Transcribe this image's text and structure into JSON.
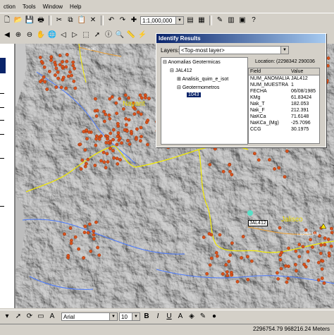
{
  "menu": [
    "ction",
    "Tools",
    "Window",
    "Help"
  ],
  "toolbar1": {
    "scale": "1:1,000,000"
  },
  "map": {
    "labels": {
      "nayarit": "Nayarit",
      "jalisco": "Jalisco",
      "identify_flag": "JAL412",
      "town_top": "Tepic",
      "town_right": "LAPREJAS"
    },
    "colors": {
      "relief": "#8a8a8a",
      "boundary": "#e8e000",
      "river": "#3060ff",
      "point": "#d04a1a",
      "highlight": "#4ad8c0"
    }
  },
  "identify": {
    "title": "Identify Results",
    "layers_label": "Layers:",
    "layers_value": "<Top-most layer>",
    "location_label": "Location:",
    "location_value": "(2298342 290036",
    "tree": {
      "root": "Anomalias Geotermicas",
      "child": "JAL412",
      "sub1": "Analisis_quim_e_isot",
      "sub2": "Geotermometros",
      "selected": "1043"
    },
    "field_header": "Field",
    "value_header": "Value",
    "fields": [
      {
        "f": "NUM_ANOMALIA",
        "v": "JAL412"
      },
      {
        "f": "NUM_MUESTRA",
        "v": "1"
      },
      {
        "f": "FECHA",
        "v": "06/08/1985"
      },
      {
        "f": "KMg",
        "v": "61.83424"
      },
      {
        "f": "Nak_T",
        "v": "182.053"
      },
      {
        "f": "Nak_F",
        "v": "212.391"
      },
      {
        "f": "NaKCa",
        "v": "71.6148"
      },
      {
        "f": "NaKCa_(Mg)",
        "v": "-25.7096"
      },
      {
        "f": "CCG",
        "v": "30.1975"
      }
    ]
  },
  "drawbar": {
    "font": "Arial",
    "size": "10"
  },
  "status": {
    "coords": "2296754.79  968216.24 Meters"
  }
}
